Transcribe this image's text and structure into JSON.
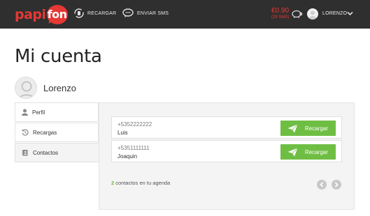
{
  "brand": {
    "logo_left": "papi",
    "logo_right": "fon",
    "color": "#e53935"
  },
  "nav": {
    "recargar": {
      "label": "RECARGAR",
      "icon": "refresh-phone-icon"
    },
    "sms": {
      "label": "ENVIAR SMS",
      "icon": "chat-bubble-icon"
    }
  },
  "account": {
    "balance": "€0.90",
    "sms_count": "(28 SMS)",
    "user_name": "LORENZO"
  },
  "page": {
    "title": "Mi cuenta",
    "profile_name": "Lorenzo"
  },
  "sidebar": {
    "items": [
      {
        "label": "Perfil",
        "icon": "user-icon"
      },
      {
        "label": "Recargas",
        "icon": "history-icon"
      },
      {
        "label": "Contactos",
        "icon": "address-book-icon",
        "active": true
      }
    ]
  },
  "contacts": {
    "rows": [
      {
        "phone": "+5352222222",
        "name": "Luis",
        "button": "Recargar"
      },
      {
        "phone": "+5351111111",
        "name": "Joaquin",
        "button": "Recargar"
      }
    ],
    "count": "2",
    "count_label": " contactos en tu agenda"
  },
  "colors": {
    "accent_green": "#6fbe44",
    "topbar": "#2f2f2f",
    "balance_red": "#e53935"
  }
}
